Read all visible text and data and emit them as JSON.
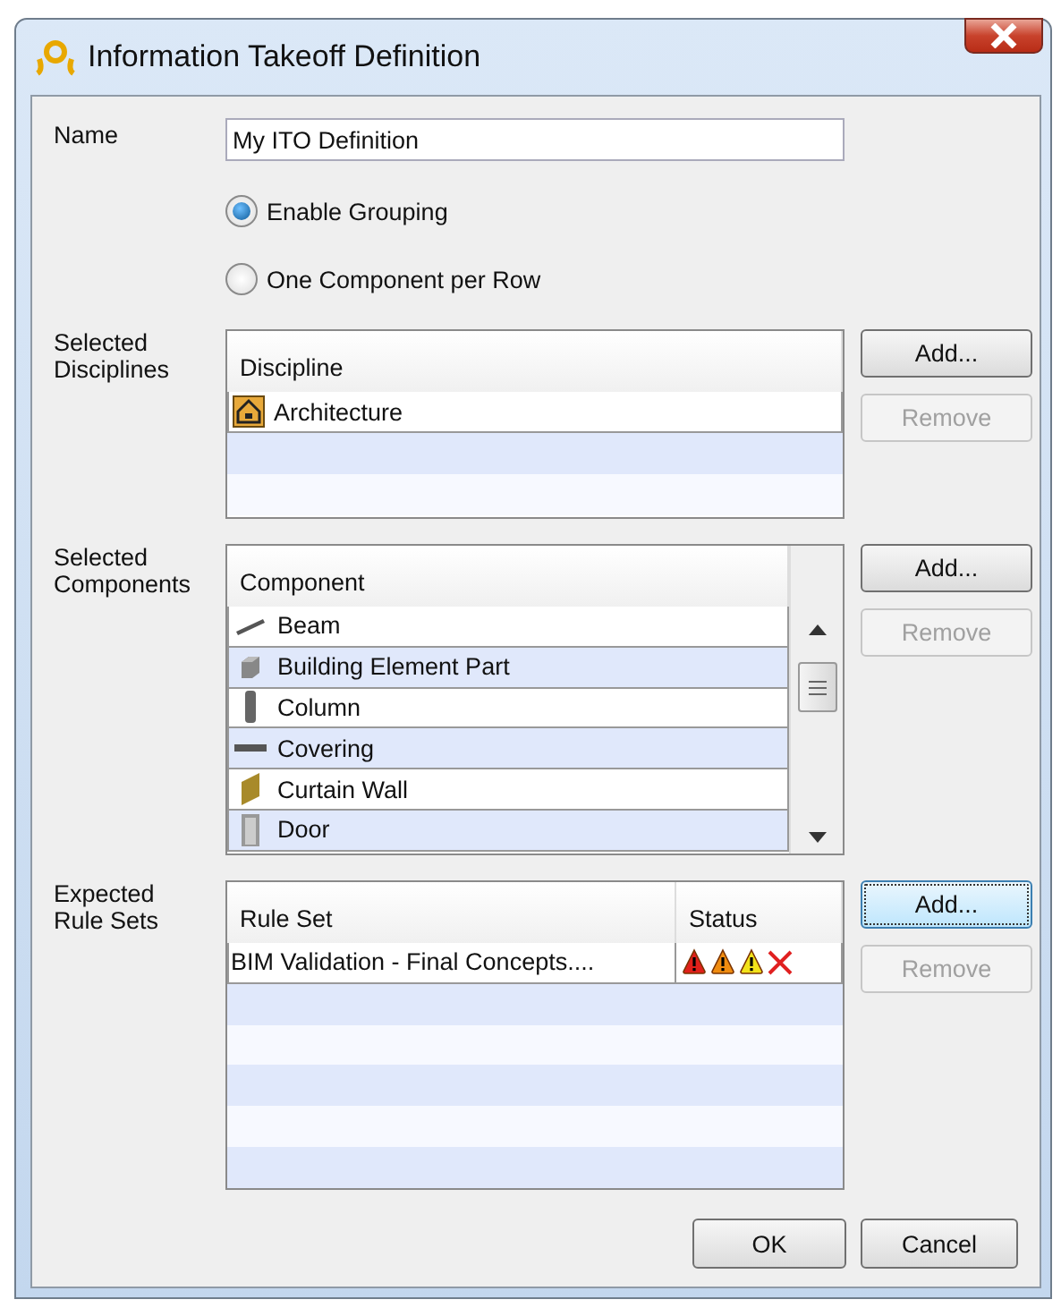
{
  "window": {
    "title": "Information Takeoff Definition"
  },
  "name": {
    "label": "Name",
    "value": "My ITO Definition"
  },
  "grouping": [
    {
      "label": "Enable Grouping",
      "selected": true
    },
    {
      "label": "One Component per Row",
      "selected": false
    }
  ],
  "disciplines": {
    "label": "Selected Disciplines",
    "column": "Discipline",
    "rows": [
      {
        "name": "Architecture"
      }
    ],
    "buttons": [
      {
        "label": "Add...",
        "disabled": false,
        "focused": false
      },
      {
        "label": "Remove",
        "disabled": true,
        "focused": false
      }
    ]
  },
  "components": {
    "label": "Selected Components",
    "column": "Component",
    "rows": [
      {
        "name": "Beam",
        "kind": "beam"
      },
      {
        "name": "Building Element Part",
        "kind": "part"
      },
      {
        "name": "Column",
        "kind": "column"
      },
      {
        "name": "Covering",
        "kind": "covering"
      },
      {
        "name": "Curtain Wall",
        "kind": "wall"
      },
      {
        "name": "Door",
        "kind": "door"
      }
    ],
    "buttons": [
      {
        "label": "Add...",
        "disabled": false,
        "focused": false
      },
      {
        "label": "Remove",
        "disabled": true,
        "focused": false
      }
    ]
  },
  "rule_sets": {
    "label": "Expected Rule Sets",
    "columns": [
      "Rule Set",
      "Status"
    ],
    "rows": [
      {
        "name": "BIM Validation - Final Concepts...."
      }
    ],
    "buttons": [
      {
        "label": "Add...",
        "disabled": false,
        "focused": true
      },
      {
        "label": "Remove",
        "disabled": true,
        "focused": false
      }
    ]
  },
  "buttons": [
    {
      "label": "OK"
    },
    {
      "label": "Cancel"
    }
  ]
}
